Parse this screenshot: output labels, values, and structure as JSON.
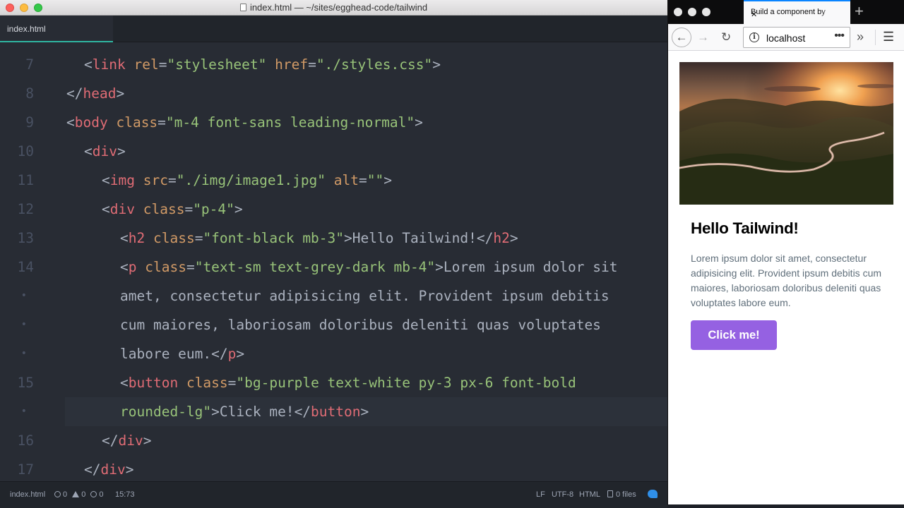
{
  "editor": {
    "window_title": "index.html — ~/sites/egghead-code/tailwind",
    "tab_label": "index.html",
    "lines": [
      {
        "num": "7",
        "tokens": [
          [
            "p",
            "<"
          ],
          [
            "t",
            "link"
          ],
          [
            "x",
            " "
          ],
          [
            "a",
            "rel"
          ],
          [
            "p",
            "="
          ],
          [
            "s",
            "\"stylesheet\""
          ],
          [
            "x",
            " "
          ],
          [
            "a",
            "href"
          ],
          [
            "p",
            "="
          ],
          [
            "s",
            "\"./styles.css\""
          ],
          [
            "p",
            ">"
          ]
        ]
      },
      {
        "num": "8",
        "tokens": [
          [
            "p",
            "</"
          ],
          [
            "t",
            "head"
          ],
          [
            "p",
            ">"
          ]
        ]
      },
      {
        "num": "9",
        "tokens": [
          [
            "p",
            "<"
          ],
          [
            "t",
            "body"
          ],
          [
            "x",
            " "
          ],
          [
            "a",
            "class"
          ],
          [
            "p",
            "="
          ],
          [
            "s",
            "\"m-4 font-sans leading-normal\""
          ],
          [
            "p",
            ">"
          ]
        ]
      },
      {
        "num": "10",
        "tokens": [
          [
            "p",
            "<"
          ],
          [
            "t",
            "div"
          ],
          [
            "p",
            ">"
          ]
        ]
      },
      {
        "num": "11",
        "tokens": [
          [
            "p",
            "<"
          ],
          [
            "t",
            "img"
          ],
          [
            "x",
            " "
          ],
          [
            "a",
            "src"
          ],
          [
            "p",
            "="
          ],
          [
            "s",
            "\"./img/image1.jpg\""
          ],
          [
            "x",
            " "
          ],
          [
            "a",
            "alt"
          ],
          [
            "p",
            "="
          ],
          [
            "s",
            "\"\""
          ],
          [
            "p",
            ">"
          ]
        ]
      },
      {
        "num": "12",
        "tokens": [
          [
            "p",
            "<"
          ],
          [
            "t",
            "div"
          ],
          [
            "x",
            " "
          ],
          [
            "a",
            "class"
          ],
          [
            "p",
            "="
          ],
          [
            "s",
            "\"p-4\""
          ],
          [
            "p",
            ">"
          ]
        ]
      },
      {
        "num": "13",
        "tokens": [
          [
            "p",
            "<"
          ],
          [
            "t",
            "h2"
          ],
          [
            "x",
            " "
          ],
          [
            "a",
            "class"
          ],
          [
            "p",
            "="
          ],
          [
            "s",
            "\"font-black mb-3\""
          ],
          [
            "p",
            ">"
          ],
          [
            "x",
            "Hello Tailwind!"
          ],
          [
            "p",
            "</"
          ],
          [
            "t",
            "h2"
          ],
          [
            "p",
            ">"
          ]
        ]
      },
      {
        "num": "14",
        "tokens": [
          [
            "p",
            "<"
          ],
          [
            "t",
            "p"
          ],
          [
            "x",
            " "
          ],
          [
            "a",
            "class"
          ],
          [
            "p",
            "="
          ],
          [
            "s",
            "\"text-sm text-grey-dark mb-4\""
          ],
          [
            "p",
            ">"
          ],
          [
            "x",
            "Lorem ipsum dolor sit"
          ]
        ]
      },
      {
        "num": "•",
        "tokens": [
          [
            "x",
            "amet, consectetur adipisicing elit. Provident ipsum debitis"
          ]
        ]
      },
      {
        "num": "•",
        "tokens": [
          [
            "x",
            "cum maiores, laboriosam doloribus deleniti quas voluptates"
          ]
        ]
      },
      {
        "num": "•",
        "tokens": [
          [
            "x",
            "labore eum."
          ],
          [
            "p",
            "</"
          ],
          [
            "t",
            "p"
          ],
          [
            "p",
            ">"
          ]
        ]
      },
      {
        "num": "15",
        "tokens": [
          [
            "p",
            "<"
          ],
          [
            "t",
            "button"
          ],
          [
            "x",
            " "
          ],
          [
            "a",
            "class"
          ],
          [
            "p",
            "="
          ],
          [
            "s",
            "\"bg-purple text-white py-3 px-6 font-bold"
          ]
        ]
      },
      {
        "num": "•",
        "tokens": [
          [
            "s",
            "rounded-lg\""
          ],
          [
            "p",
            ">"
          ],
          [
            "x",
            "Click me!"
          ],
          [
            "p",
            "</"
          ],
          [
            "t",
            "button"
          ],
          [
            "p",
            ">"
          ]
        ]
      },
      {
        "num": "16",
        "tokens": [
          [
            "p",
            "</"
          ],
          [
            "t",
            "div"
          ],
          [
            "p",
            ">"
          ]
        ]
      },
      {
        "num": "17",
        "tokens": [
          [
            "p",
            "</"
          ],
          [
            "t",
            "div"
          ],
          [
            "p",
            ">"
          ]
        ]
      }
    ],
    "status": {
      "file": "index.html",
      "errors": "0",
      "warnings": "0",
      "infos": "0",
      "cursor": "15:73",
      "line_ending": "LF",
      "encoding": "UTF-8",
      "grammar": "HTML",
      "files": "0 files"
    }
  },
  "browser": {
    "tab_title": "Build a component by",
    "url": "localhost",
    "card": {
      "title": "Hello Tailwind!",
      "text": "Lorem ipsum dolor sit amet, consectetur adipisicing elit. Provident ipsum debitis cum maiores, laboriosam doloribus deleniti quas voluptates labore eum.",
      "button": "Click me!"
    }
  },
  "colors": {
    "editor_bg": "#282c34",
    "tab_accent": "#2fb5a0",
    "button_purple": "#9561e2",
    "firefox_tab_accent": "#0a84ff"
  }
}
